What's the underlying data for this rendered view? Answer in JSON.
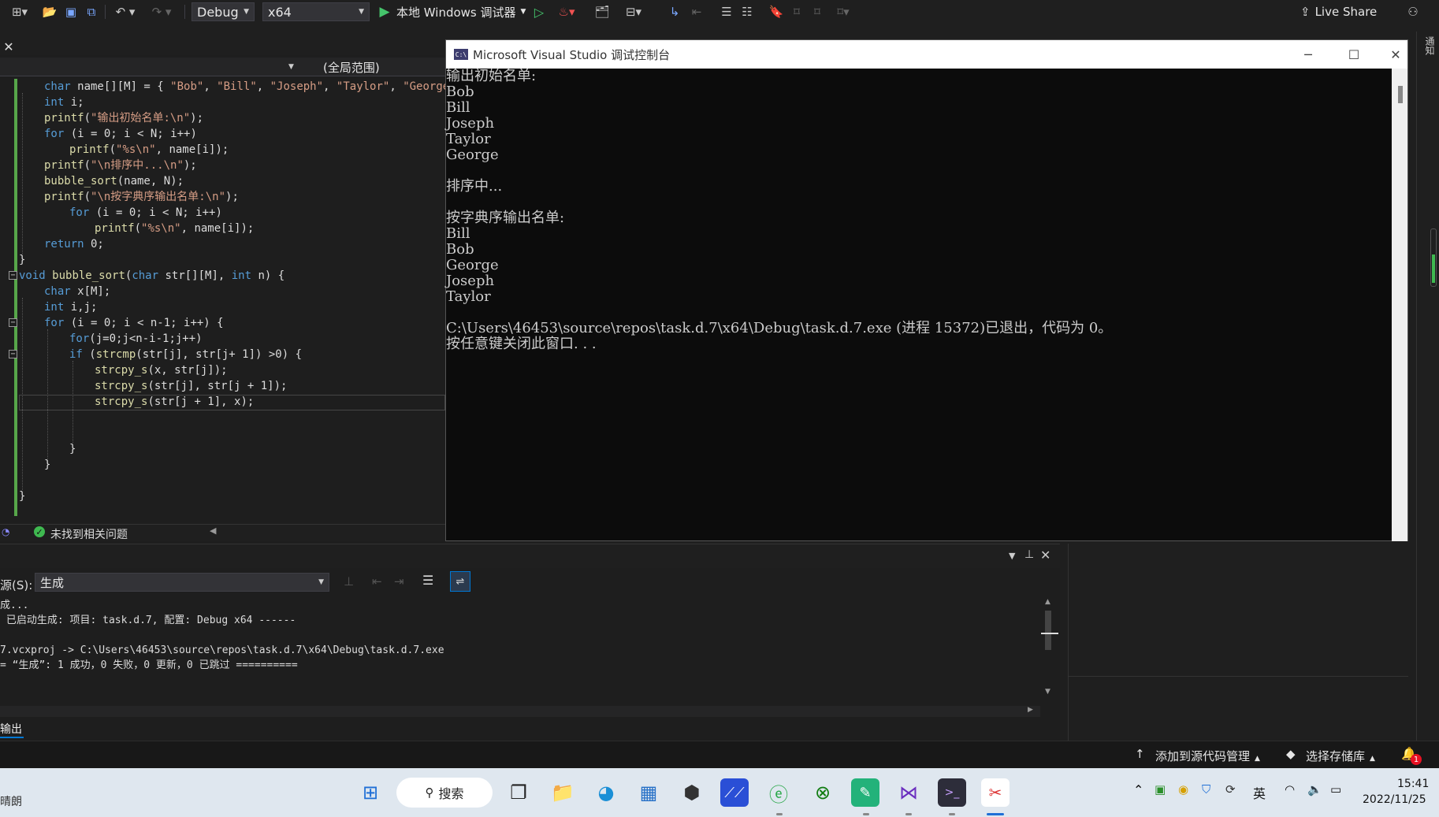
{
  "toolbar": {
    "config": "Debug",
    "platform": "x64",
    "run_label": "本地 Windows 调试器",
    "live_share": "Live Share"
  },
  "editor": {
    "scope": "(全局范围)",
    "lines": [
      {
        "indent": 2,
        "html": "<span class='kw'>char</span> name[][M] = { <span class='st'>\"Bob\"</span>, <span class='st'>\"Bill\"</span>, <span class='st'>\"Joseph\"</span>, <span class='st'>\"Taylor\"</span>, <span class='st'>\"George\"</span>"
      },
      {
        "indent": 2,
        "html": "<span class='kw'>int</span> i;"
      },
      {
        "indent": 2,
        "html": "<span class='fn'>printf</span>(<span class='st'>\"输出初始名单:\\n\"</span>);"
      },
      {
        "indent": 2,
        "html": "<span class='kw'>for</span> (i = 0; i &lt; N; i++)"
      },
      {
        "indent": 3,
        "html": "<span class='fn'>printf</span>(<span class='st'>\"%s\\n\"</span>, name[i]);"
      },
      {
        "indent": 2,
        "html": "<span class='fn'>printf</span>(<span class='st'>\"\\n排序中...\\n\"</span>);"
      },
      {
        "indent": 2,
        "html": "<span class='fn'>bubble_sort</span>(name, N);"
      },
      {
        "indent": 2,
        "html": "<span class='fn'>printf</span>(<span class='st'>\"\\n按字典序输出名单:\\n\"</span>);"
      },
      {
        "indent": 3,
        "html": "<span class='kw'>for</span> (i = 0; i &lt; N; i++)"
      },
      {
        "indent": 4,
        "html": "<span class='fn'>printf</span>(<span class='st'>\"%s\\n\"</span>, name[i]);"
      },
      {
        "indent": 2,
        "html": "<span class='kw'>return</span> 0;"
      },
      {
        "indent": 1,
        "html": "}"
      },
      {
        "indent": 1,
        "html": "<span class='kw'>void</span> <span class='fn'>bubble_sort</span>(<span class='kw'>char</span> str[][M], <span class='kw'>int</span> n) {"
      },
      {
        "indent": 2,
        "html": "<span class='kw'>char</span> x[M];"
      },
      {
        "indent": 2,
        "html": "<span class='kw'>int</span> i,j;"
      },
      {
        "indent": 2,
        "html": "<span class='kw'>for</span> (i = 0; i &lt; n-1; i++) {"
      },
      {
        "indent": 3,
        "html": "<span class='kw'>for</span>(j=0;j&lt;n-i-1;j++)"
      },
      {
        "indent": 3,
        "html": "<span class='kw'>if</span> (<span class='fn'>strcmp</span>(str[j], str[j+ 1]) &gt;0) {"
      },
      {
        "indent": 4,
        "html": "<span class='fn'>strcpy_s</span>(x, str[j]);"
      },
      {
        "indent": 4,
        "html": "<span class='fn'>strcpy_s</span>(str[j], str[j + 1]);"
      },
      {
        "indent": 4,
        "html": "<span class='fn'>strcpy_s</span>(str[j + 1], x);"
      },
      {
        "indent": 3,
        "html": ""
      },
      {
        "indent": 3,
        "html": ""
      },
      {
        "indent": 3,
        "html": "}"
      },
      {
        "indent": 2,
        "html": "}"
      },
      {
        "indent": 1,
        "html": ""
      },
      {
        "indent": 1,
        "html": "}"
      }
    ],
    "status": "未找到相关问题"
  },
  "console": {
    "title": "Microsoft Visual Studio 调试控制台",
    "lines": [
      "输出初始名单:",
      "Bob",
      "Bill",
      "Joseph",
      "Taylor",
      "George",
      "",
      "排序中...",
      "",
      "按字典序输出名单:",
      "Bill",
      "Bob",
      "George",
      "Joseph",
      "Taylor",
      "",
      "C:\\Users\\46453\\source\\repos\\task.d.7\\x64\\Debug\\task.d.7.exe (进程 15372)已退出，代码为 0。",
      "按任意键关闭此窗口. . ."
    ]
  },
  "output": {
    "source_label": "源(S):",
    "source_value": "生成",
    "lines": [
      "成...",
      " 已启动生成: 项目: task.d.7, 配置: Debug x64 ------",
      "",
      "7.vcxproj -> C:\\Users\\46453\\source\\repos\\task.d.7\\x64\\Debug\\task.d.7.exe",
      "= “生成”: 1 成功，0 失败，0 更新，0 已跳过 =========="
    ],
    "tab": "输出"
  },
  "statusbar": {
    "add_source": "添加到源代码管理",
    "select_repo": "选择存储库",
    "notif_count": "1"
  },
  "taskbar": {
    "weather": "晴朗",
    "search": "搜索",
    "time": "15:41",
    "date": "2022/11/25",
    "ime": "英"
  },
  "colors": {
    "accent": "#0078d4",
    "green_bar": "#57a64a",
    "console_bg": "#0c0c0c"
  }
}
